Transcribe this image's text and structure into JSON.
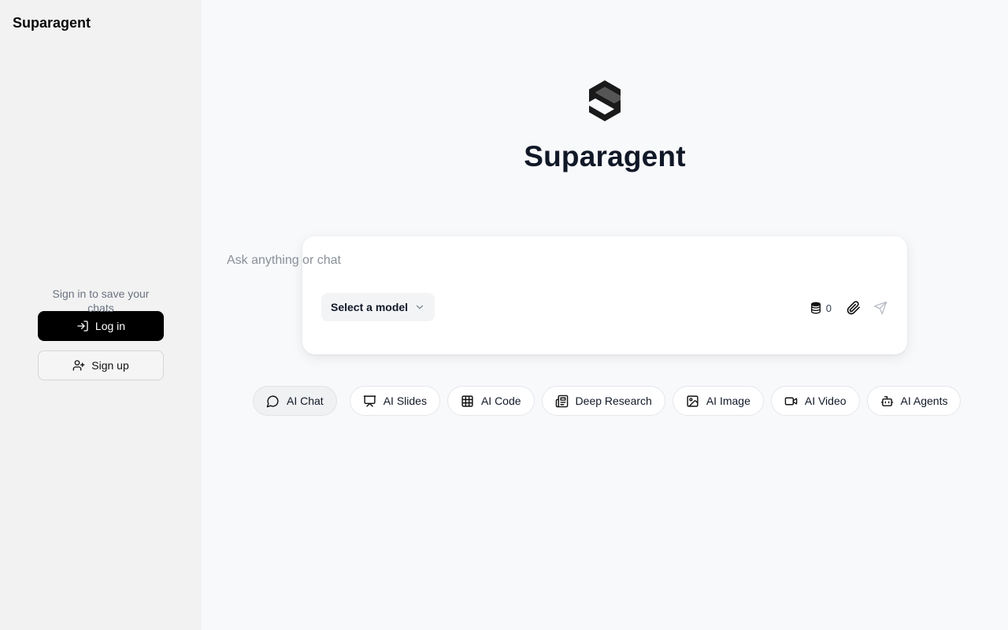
{
  "sidebar": {
    "brand": "Suparagent",
    "signin_prompt": "Sign in to save your chats",
    "login_label": "Log in",
    "signup_label": "Sign up"
  },
  "main": {
    "title": "Suparagent",
    "chat": {
      "placeholder": "Ask anything or chat",
      "value": "",
      "model_label": "Select a model",
      "credits": "0"
    },
    "modes": [
      {
        "label": "AI Chat",
        "icon": "message-circle-icon",
        "active": true
      },
      {
        "label": "AI Slides",
        "icon": "presentation-icon",
        "active": false
      },
      {
        "label": "AI Code",
        "icon": "grid-icon",
        "active": false
      },
      {
        "label": "Deep Research",
        "icon": "newspaper-icon",
        "active": false
      },
      {
        "label": "AI Image",
        "icon": "image-icon",
        "active": false
      },
      {
        "label": "AI Video",
        "icon": "video-icon",
        "active": false
      },
      {
        "label": "AI Agents",
        "icon": "bot-icon",
        "active": false
      }
    ]
  },
  "colors": {
    "sidebar_bg": "#f2f2f2",
    "page_bg": "#f8f9fb",
    "primary_button": "#000000",
    "title": "#111827",
    "muted_text": "#6b7280"
  }
}
